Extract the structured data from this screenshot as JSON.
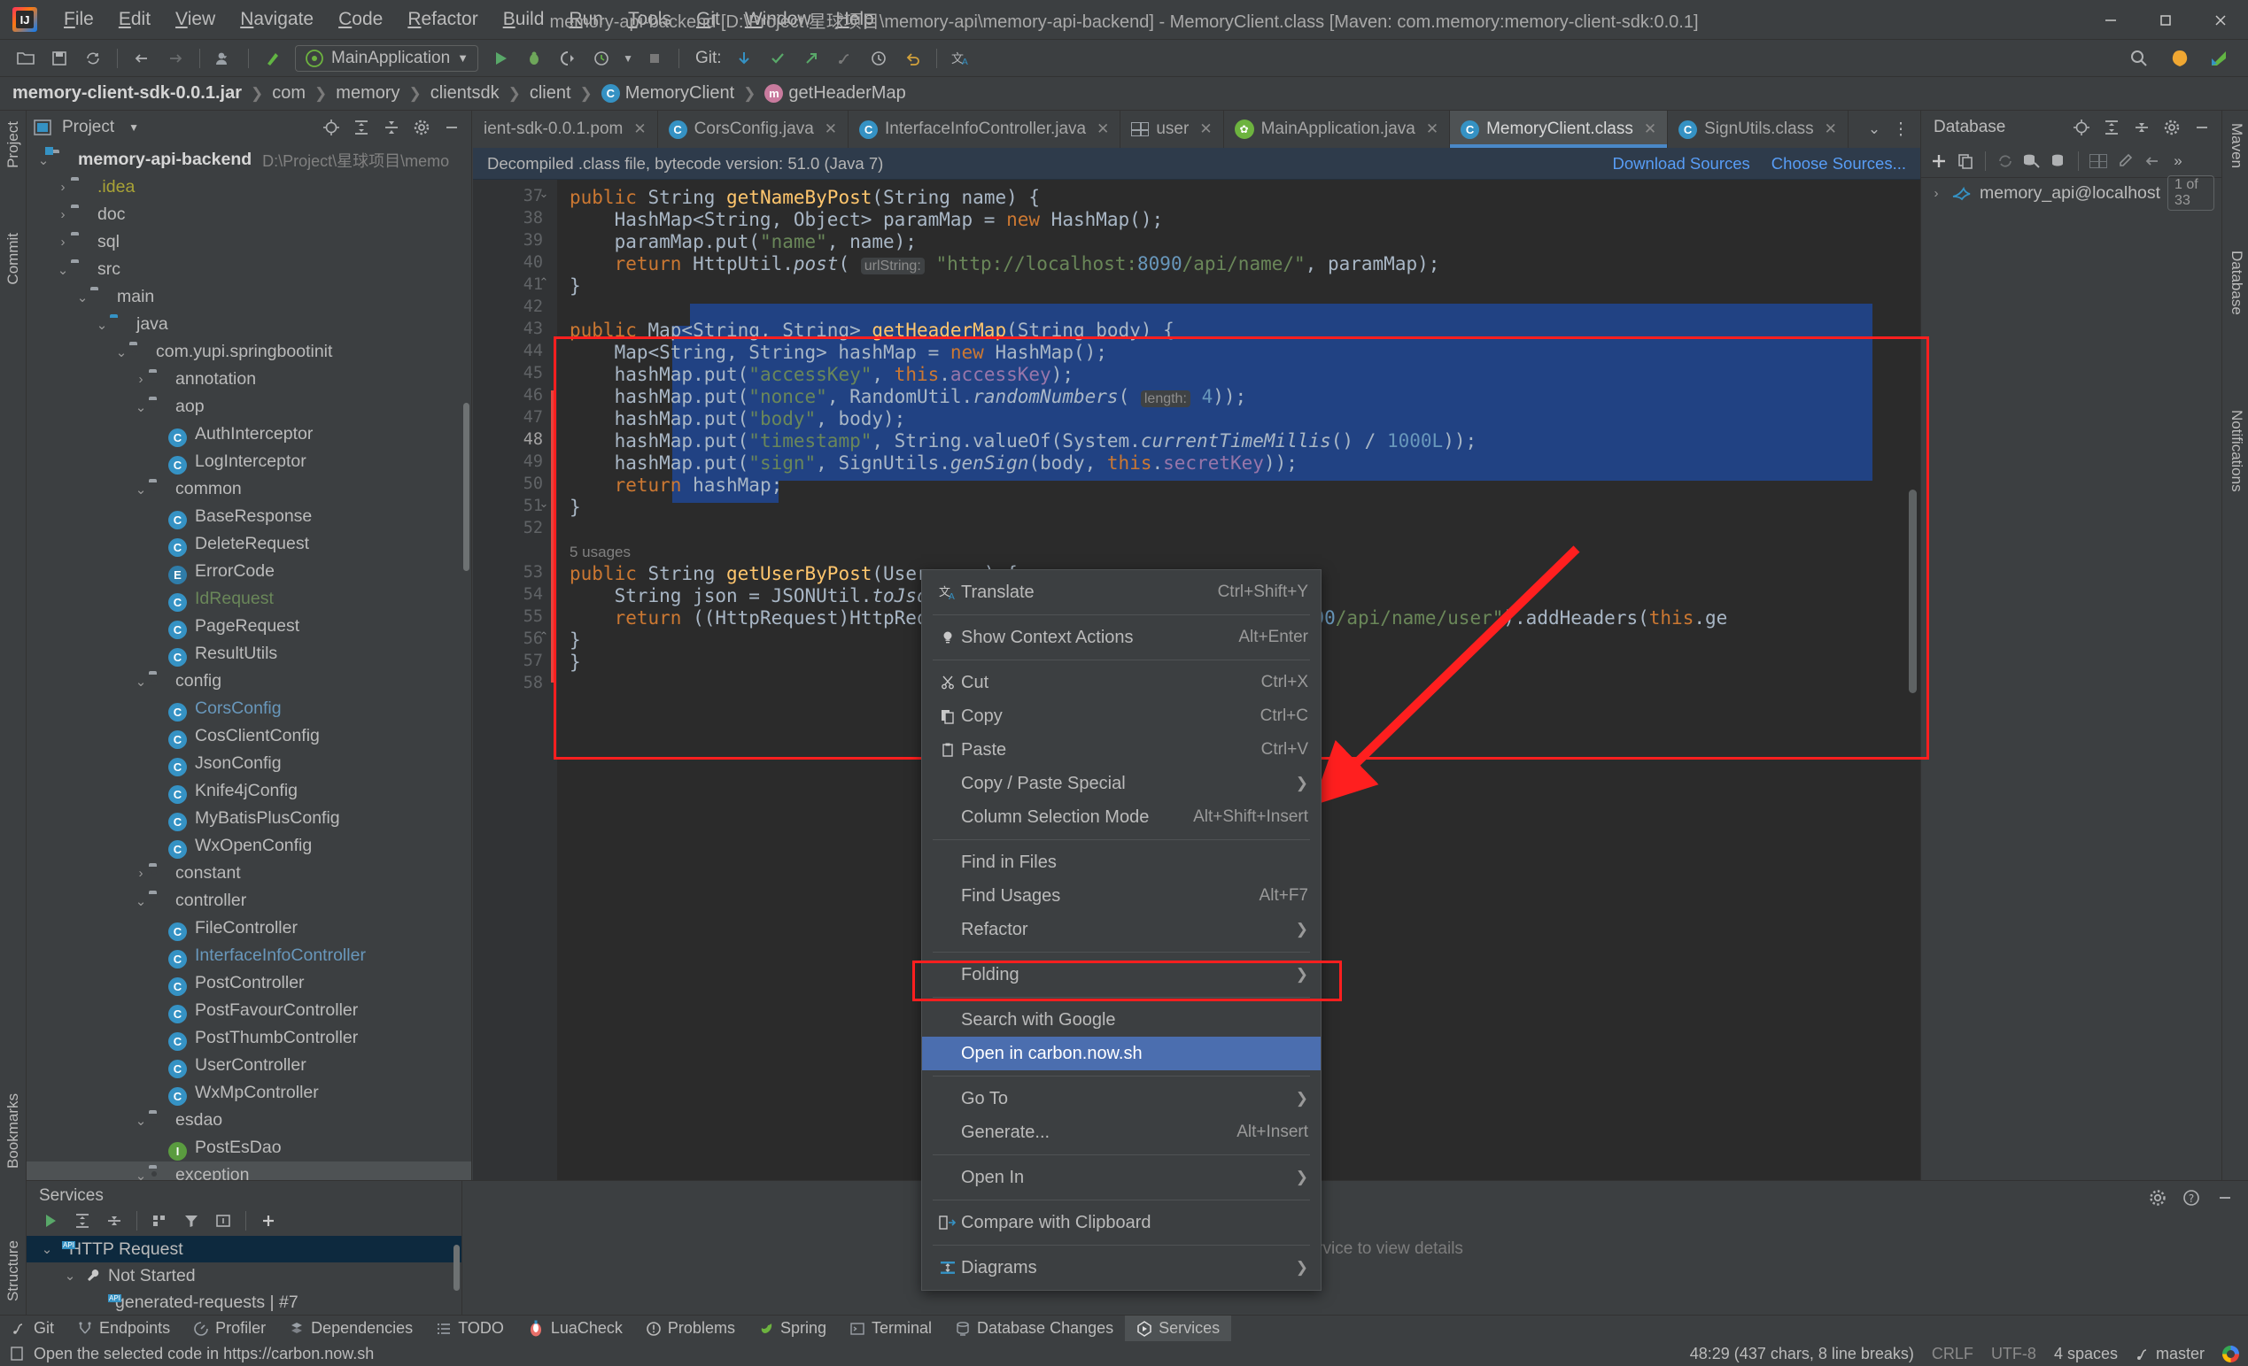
{
  "window": {
    "title": "memory-api-backend [D:\\Project\\星球项目\\memory-api\\memory-api-backend] - MemoryClient.class [Maven: com.memory:memory-client-sdk:0.0.1]",
    "minimize": "—",
    "maximize": "❐",
    "close": "✕"
  },
  "menubar": [
    "File",
    "Edit",
    "View",
    "Navigate",
    "Code",
    "Refactor",
    "Build",
    "Run",
    "Tools",
    "Git",
    "Window",
    "Help"
  ],
  "toolbar": {
    "run_config": "MainApplication",
    "git_label": "Git:"
  },
  "breadcrumb": [
    {
      "label": "memory-client-sdk-0.0.1.jar",
      "icon": null,
      "bold": true
    },
    {
      "label": "com",
      "icon": null,
      "bold": false
    },
    {
      "label": "memory",
      "icon": null,
      "bold": false
    },
    {
      "label": "clientsdk",
      "icon": null,
      "bold": false
    },
    {
      "label": "client",
      "icon": null,
      "bold": false
    },
    {
      "label": "MemoryClient",
      "icon": "class-icon",
      "bold": false
    },
    {
      "label": "getHeaderMap",
      "icon": "method-icon",
      "bold": false
    }
  ],
  "project_panel": {
    "title": "Project",
    "tree": [
      {
        "depth": 0,
        "arrow": "v",
        "icon": "module-folder",
        "label": "memory-api-backend",
        "style": "bold",
        "path": "D:\\Project\\星球项目\\memo"
      },
      {
        "depth": 1,
        "arrow": ">",
        "icon": "folder",
        "label": ".idea",
        "style": "yellow"
      },
      {
        "depth": 1,
        "arrow": ">",
        "icon": "folder",
        "label": "doc",
        "style": ""
      },
      {
        "depth": 1,
        "arrow": ">",
        "icon": "folder",
        "label": "sql",
        "style": ""
      },
      {
        "depth": 1,
        "arrow": "v",
        "icon": "folder",
        "label": "src",
        "style": ""
      },
      {
        "depth": 2,
        "arrow": "v",
        "icon": "folder",
        "label": "main",
        "style": ""
      },
      {
        "depth": 3,
        "arrow": "v",
        "icon": "folder-blue",
        "label": "java",
        "style": ""
      },
      {
        "depth": 4,
        "arrow": "v",
        "icon": "package",
        "label": "com.yupi.springbootinit",
        "style": ""
      },
      {
        "depth": 5,
        "arrow": ">",
        "icon": "package",
        "label": "annotation",
        "style": ""
      },
      {
        "depth": 5,
        "arrow": "v",
        "icon": "package",
        "label": "aop",
        "style": ""
      },
      {
        "depth": 6,
        "arrow": "",
        "icon": "class",
        "label": "AuthInterceptor",
        "style": ""
      },
      {
        "depth": 6,
        "arrow": "",
        "icon": "class",
        "label": "LogInterceptor",
        "style": ""
      },
      {
        "depth": 5,
        "arrow": "v",
        "icon": "package",
        "label": "common",
        "style": ""
      },
      {
        "depth": 6,
        "arrow": "",
        "icon": "class",
        "label": "BaseResponse",
        "style": ""
      },
      {
        "depth": 6,
        "arrow": "",
        "icon": "class",
        "label": "DeleteRequest",
        "style": ""
      },
      {
        "depth": 6,
        "arrow": "",
        "icon": "enum",
        "label": "ErrorCode",
        "style": ""
      },
      {
        "depth": 6,
        "arrow": "",
        "icon": "class",
        "label": "IdRequest",
        "style": "green"
      },
      {
        "depth": 6,
        "arrow": "",
        "icon": "class",
        "label": "PageRequest",
        "style": ""
      },
      {
        "depth": 6,
        "arrow": "",
        "icon": "class",
        "label": "ResultUtils",
        "style": ""
      },
      {
        "depth": 5,
        "arrow": "v",
        "icon": "package",
        "label": "config",
        "style": ""
      },
      {
        "depth": 6,
        "arrow": "",
        "icon": "class",
        "label": "CorsConfig",
        "style": "blue"
      },
      {
        "depth": 6,
        "arrow": "",
        "icon": "class",
        "label": "CosClientConfig",
        "style": ""
      },
      {
        "depth": 6,
        "arrow": "",
        "icon": "class",
        "label": "JsonConfig",
        "style": ""
      },
      {
        "depth": 6,
        "arrow": "",
        "icon": "class",
        "label": "Knife4jConfig",
        "style": ""
      },
      {
        "depth": 6,
        "arrow": "",
        "icon": "class",
        "label": "MyBatisPlusConfig",
        "style": ""
      },
      {
        "depth": 6,
        "arrow": "",
        "icon": "class",
        "label": "WxOpenConfig",
        "style": ""
      },
      {
        "depth": 5,
        "arrow": ">",
        "icon": "package",
        "label": "constant",
        "style": ""
      },
      {
        "depth": 5,
        "arrow": "v",
        "icon": "package",
        "label": "controller",
        "style": ""
      },
      {
        "depth": 6,
        "arrow": "",
        "icon": "class",
        "label": "FileController",
        "style": ""
      },
      {
        "depth": 6,
        "arrow": "",
        "icon": "class",
        "label": "InterfaceInfoController",
        "style": "blue"
      },
      {
        "depth": 6,
        "arrow": "",
        "icon": "class",
        "label": "PostController",
        "style": ""
      },
      {
        "depth": 6,
        "arrow": "",
        "icon": "class",
        "label": "PostFavourController",
        "style": ""
      },
      {
        "depth": 6,
        "arrow": "",
        "icon": "class",
        "label": "PostThumbController",
        "style": ""
      },
      {
        "depth": 6,
        "arrow": "",
        "icon": "class",
        "label": "UserController",
        "style": ""
      },
      {
        "depth": 6,
        "arrow": "",
        "icon": "class",
        "label": "WxMpController",
        "style": ""
      },
      {
        "depth": 5,
        "arrow": "v",
        "icon": "package",
        "label": "esdao",
        "style": ""
      },
      {
        "depth": 6,
        "arrow": "",
        "icon": "interface",
        "label": "PostEsDao",
        "style": ""
      },
      {
        "depth": 5,
        "arrow": "v",
        "icon": "package",
        "label": "exception",
        "style": ""
      }
    ]
  },
  "editor": {
    "tabs": [
      {
        "label": "ient-sdk-0.0.1.pom",
        "icon": "none",
        "active": false,
        "closable": true
      },
      {
        "label": "CorsConfig.java",
        "icon": "class-icon",
        "active": false,
        "closable": true
      },
      {
        "label": "InterfaceInfoController.java",
        "icon": "class-icon",
        "active": false,
        "closable": true
      },
      {
        "label": "user",
        "icon": "table-icon",
        "active": false,
        "closable": true
      },
      {
        "label": "MainApplication.java",
        "icon": "spring-icon",
        "active": false,
        "closable": true
      },
      {
        "label": "MemoryClient.class",
        "icon": "class-icon",
        "active": true,
        "closable": true
      },
      {
        "label": "SignUtils.class",
        "icon": "class-icon",
        "active": false,
        "closable": true
      }
    ],
    "notification": {
      "message": "Decompiled .class file, bytecode version: 51.0 (Java 7)",
      "links": [
        "Download Sources",
        "Choose Sources..."
      ]
    },
    "line_numbers": [
      "37",
      "38",
      "39",
      "40",
      "41",
      "42",
      "43",
      "44",
      "45",
      "46",
      "47",
      "48",
      "49",
      "50",
      "51",
      "52",
      "53",
      "54",
      "55",
      "56",
      "57",
      "58"
    ],
    "code_lines": [
      "public String getNameByPost(String name) {",
      "    HashMap<String, Object> paramMap = new HashMap();",
      "    paramMap.put(\"name\", name);",
      "    return HttpUtil.post( urlString: \"http://localhost:8090/api/name/\", paramMap);",
      "}",
      "",
      "public Map<String, String> getHeaderMap(String body) {",
      "    Map<String, String> hashMap = new HashMap();",
      "    hashMap.put(\"accessKey\", this.accessKey);",
      "    hashMap.put(\"nonce\", RandomUtil.randomNumbers( length: 4));",
      "    hashMap.put(\"body\", body);",
      "    hashMap.put(\"timestamp\", String.valueOf(System.currentTimeMillis() / 1000L));",
      "    hashMap.put(\"sign\", SignUtils.genSign(body, this.secretKey));",
      "    return hashMap;",
      "}",
      "",
      "public String getUserByPost(User user) {",
      "    String json = JSONUtil.toJsonStr(user);",
      "    return ((HttpRequest)HttpRequest.post( url: \"http://localhost:8090/api/name/user\").addHeaders(this.ge",
      "}",
      "}",
      ""
    ],
    "usages_hint": "5 usages"
  },
  "context_menu": {
    "items": [
      {
        "label": "Translate",
        "shortcut": "Ctrl+Shift+Y",
        "icon": "translate-icon",
        "submenu": false,
        "selected": false,
        "sep_after": true
      },
      {
        "label": "Show Context Actions",
        "shortcut": "Alt+Enter",
        "icon": "lightbulb-icon",
        "submenu": false,
        "selected": false,
        "sep_after": true
      },
      {
        "label": "Cut",
        "shortcut": "Ctrl+X",
        "icon": "scissors-icon",
        "submenu": false,
        "selected": false,
        "sep_after": false
      },
      {
        "label": "Copy",
        "shortcut": "Ctrl+C",
        "icon": "copy-icon",
        "submenu": false,
        "selected": false,
        "sep_after": false
      },
      {
        "label": "Paste",
        "shortcut": "Ctrl+V",
        "icon": "clipboard-icon",
        "submenu": false,
        "selected": false,
        "sep_after": false
      },
      {
        "label": "Copy / Paste Special",
        "shortcut": "",
        "icon": "",
        "submenu": true,
        "selected": false,
        "sep_after": false
      },
      {
        "label": "Column Selection Mode",
        "shortcut": "Alt+Shift+Insert",
        "icon": "",
        "submenu": false,
        "selected": false,
        "sep_after": true
      },
      {
        "label": "Find in Files",
        "shortcut": "",
        "icon": "",
        "submenu": false,
        "selected": false,
        "sep_after": false
      },
      {
        "label": "Find Usages",
        "shortcut": "Alt+F7",
        "icon": "",
        "submenu": false,
        "selected": false,
        "sep_after": false
      },
      {
        "label": "Refactor",
        "shortcut": "",
        "icon": "",
        "submenu": true,
        "selected": false,
        "sep_after": true
      },
      {
        "label": "Folding",
        "shortcut": "",
        "icon": "",
        "submenu": true,
        "selected": false,
        "sep_after": true
      },
      {
        "label": "Search with Google",
        "shortcut": "",
        "icon": "",
        "submenu": false,
        "selected": false,
        "sep_after": false
      },
      {
        "label": "Open in carbon.now.sh",
        "shortcut": "",
        "icon": "",
        "submenu": false,
        "selected": true,
        "sep_after": true
      },
      {
        "label": "Go To",
        "shortcut": "",
        "icon": "",
        "submenu": true,
        "selected": false,
        "sep_after": false
      },
      {
        "label": "Generate...",
        "shortcut": "Alt+Insert",
        "icon": "",
        "submenu": false,
        "selected": false,
        "sep_after": true
      },
      {
        "label": "Open In",
        "shortcut": "",
        "icon": "",
        "submenu": true,
        "selected": false,
        "sep_after": true
      },
      {
        "label": "Compare with Clipboard",
        "shortcut": "",
        "icon": "compare-icon",
        "submenu": false,
        "selected": false,
        "sep_after": true
      },
      {
        "label": "Diagrams",
        "shortcut": "",
        "icon": "diagram-icon",
        "submenu": true,
        "selected": false,
        "sep_after": false
      }
    ]
  },
  "database_panel": {
    "title": "Database",
    "datasource": "memory_api@localhost",
    "badge": "1 of 33"
  },
  "services_panel": {
    "title": "Services",
    "rows": [
      {
        "depth": 0,
        "arrow": "v",
        "icon": "api-icon",
        "label": "HTTP Request",
        "selected": true
      },
      {
        "depth": 1,
        "arrow": "v",
        "icon": "wrench-icon",
        "label": "Not Started",
        "selected": false
      },
      {
        "depth": 2,
        "arrow": "",
        "icon": "api-icon",
        "label": "generated-requests | #7",
        "selected": false
      }
    ],
    "placeholder": "Select service to view details"
  },
  "left_rail": [
    "Project",
    "Commit",
    "Structure",
    "Bookmarks"
  ],
  "right_rail": [
    "Maven",
    "Database",
    "Notifications"
  ],
  "tool_window_bar": [
    {
      "label": "Git",
      "icon": "git-icon",
      "active": false
    },
    {
      "label": "Endpoints",
      "icon": "endpoints-icon",
      "active": false
    },
    {
      "label": "Profiler",
      "icon": "profiler-icon",
      "active": false
    },
    {
      "label": "Dependencies",
      "icon": "dependencies-icon",
      "active": false
    },
    {
      "label": "TODO",
      "icon": "todo-icon",
      "active": false
    },
    {
      "label": "LuaCheck",
      "icon": "luacheck-icon",
      "active": false
    },
    {
      "label": "Problems",
      "icon": "problems-icon",
      "active": false
    },
    {
      "label": "Spring",
      "icon": "spring-icon",
      "active": false
    },
    {
      "label": "Terminal",
      "icon": "terminal-icon",
      "active": false
    },
    {
      "label": "Database Changes",
      "icon": "db-changes-icon",
      "active": false
    },
    {
      "label": "Services",
      "icon": "services-icon",
      "active": true
    }
  ],
  "statusbar": {
    "hint": "Open the selected code in https://carbon.now.sh",
    "caret": "48:29 (437 chars, 8 line breaks)",
    "line_sep": "CRLF",
    "encoding": "UTF-8",
    "indent": "4 spaces",
    "branch": "master"
  },
  "colors": {
    "accent_blue": "#4a88c7",
    "selection_blue": "#214283",
    "menu_select": "#4b6eaf",
    "annotation_red": "#ff1f1f",
    "bg_panel": "#3c3f41",
    "bg_editor": "#2b2b2b"
  }
}
